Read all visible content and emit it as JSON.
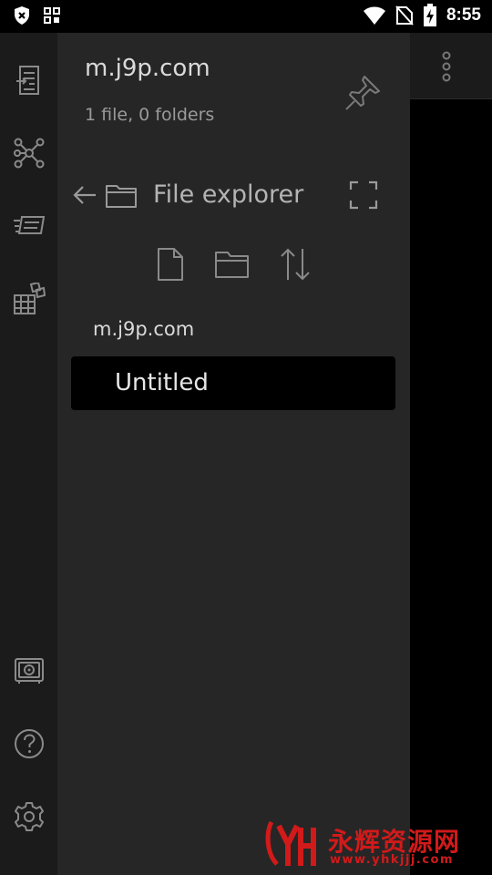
{
  "status_bar": {
    "time": "8:55",
    "icons": [
      "shield-x-icon",
      "grid-icon",
      "wifi-icon",
      "no-sim-icon",
      "battery-charging-icon"
    ]
  },
  "ribbon": {
    "top_icons": [
      "open-note-icon",
      "graph-view-icon",
      "slides-icon",
      "plugins-icon"
    ],
    "bottom_icons": [
      "vault-icon",
      "help-icon",
      "settings-icon"
    ]
  },
  "drawer": {
    "vault_name": "m.j9p.com",
    "vault_stats": "1 file, 0 folders",
    "file_explorer_title": "File explorer",
    "tree": {
      "root": "m.j9p.com",
      "files": [
        "Untitled"
      ]
    }
  },
  "watermark": {
    "text": "永辉资源网",
    "url": "www.yhkjjj.com"
  },
  "colors": {
    "ribbon_bg": "#1b1b1b",
    "drawer_bg": "#262626",
    "selected_bg": "#000000",
    "icon": "#8a8a8a",
    "watermark": "#d11a1a"
  }
}
